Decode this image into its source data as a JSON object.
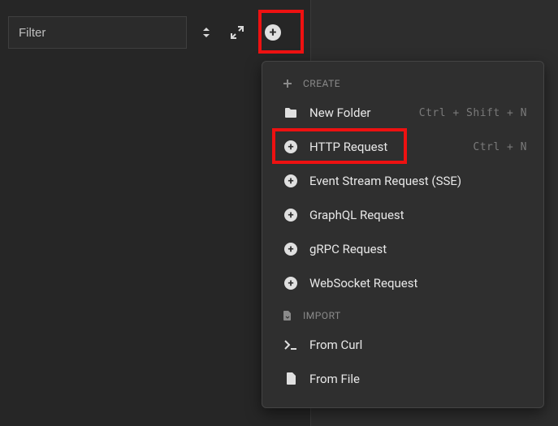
{
  "toolbar": {
    "filter_placeholder": "Filter"
  },
  "dropdown": {
    "sections": {
      "create": "CREATE",
      "import": "IMPORT"
    },
    "items": {
      "new_folder": {
        "label": "New Folder",
        "shortcut": "Ctrl + Shift + N"
      },
      "http_request": {
        "label": "HTTP Request",
        "shortcut": "Ctrl + N"
      },
      "sse_request": {
        "label": "Event Stream Request (SSE)"
      },
      "graphql_request": {
        "label": "GraphQL Request"
      },
      "grpc_request": {
        "label": "gRPC Request"
      },
      "websocket_request": {
        "label": "WebSocket Request"
      },
      "from_curl": {
        "label": "From Curl"
      },
      "from_file": {
        "label": "From File"
      }
    }
  }
}
